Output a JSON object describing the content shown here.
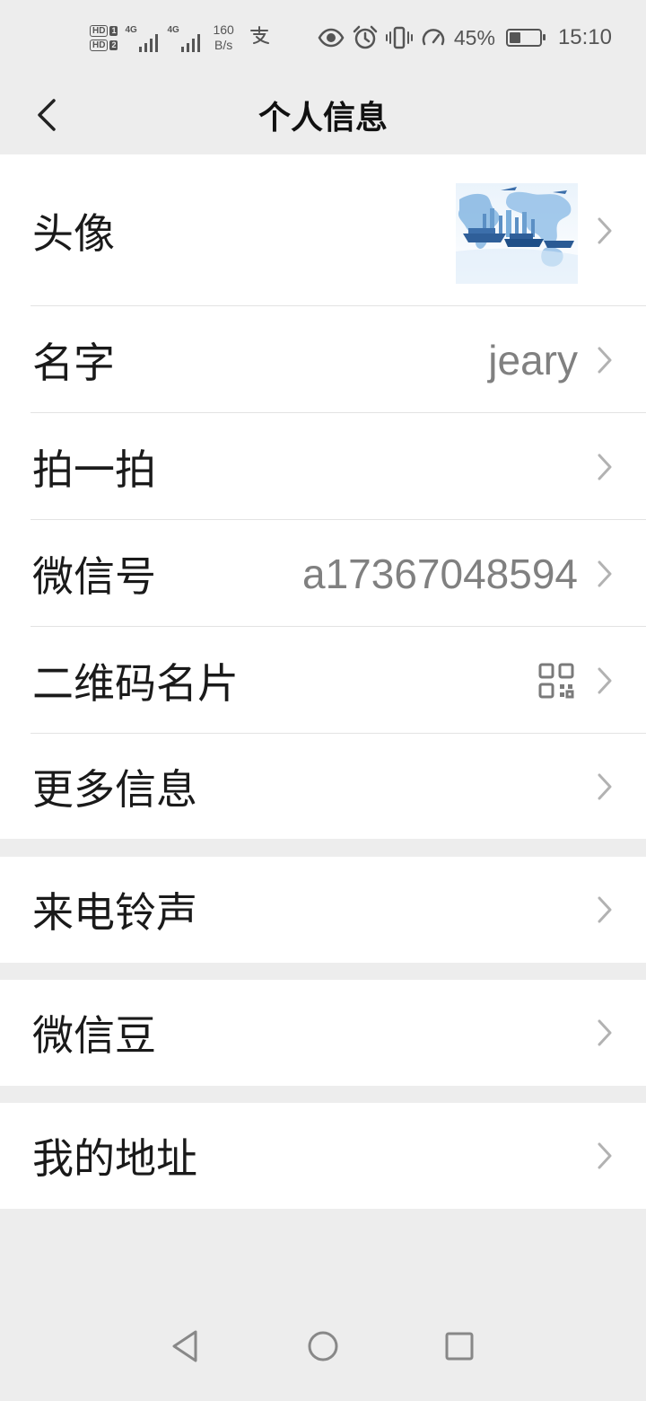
{
  "status_bar": {
    "hd1": "HD",
    "hd1_sim": "1",
    "hd2": "HD",
    "hd2_sim": "2",
    "net1": "4G",
    "net2": "4G",
    "speed_value": "160",
    "speed_unit": "B/s",
    "battery_percent": "45%",
    "battery_level": 0.45,
    "time": "15:10"
  },
  "nav": {
    "title": "个人信息"
  },
  "profile_rows": [
    {
      "label": "头像",
      "value": ""
    },
    {
      "label": "名字",
      "value": "jeary"
    },
    {
      "label": "拍一拍",
      "value": ""
    },
    {
      "label": "微信号",
      "value": "a17367048594"
    },
    {
      "label": "二维码名片",
      "value": ""
    },
    {
      "label": "更多信息",
      "value": ""
    }
  ],
  "ringtone_row": {
    "label": "来电铃声"
  },
  "beans_row": {
    "label": "微信豆"
  },
  "address_row": {
    "label": "我的地址"
  },
  "icons": {
    "back": "chevron-left-icon",
    "chevron": "chevron-right-icon",
    "qr": "qr-code-icon",
    "eye": "eye-icon",
    "alarm": "alarm-icon",
    "vibrate": "vibrate-icon",
    "speed": "speedometer-icon"
  },
  "colors": {
    "background": "#ededed",
    "card": "#ffffff",
    "text": "#1a1a1a",
    "secondary_text": "#808080"
  }
}
